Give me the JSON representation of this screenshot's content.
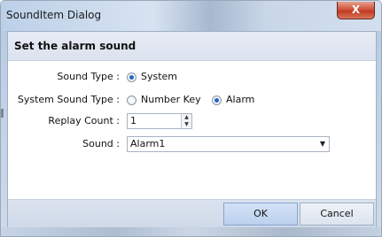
{
  "window": {
    "title": "SoundItem Dialog",
    "close_glyph": "X"
  },
  "header": {
    "title": "Set the alarm sound"
  },
  "sound_type": {
    "label": "Sound Type :",
    "options": [
      {
        "label": "System",
        "checked": true
      }
    ]
  },
  "system_sound_type": {
    "label": "System Sound Type :",
    "options": [
      {
        "label": "Number Key",
        "checked": false
      },
      {
        "label": "Alarm",
        "checked": true
      }
    ]
  },
  "replay_count": {
    "label": "Replay Count :",
    "value": "1",
    "up_glyph": "▲",
    "down_glyph": "▼"
  },
  "sound": {
    "label": "Sound :",
    "selected": "Alarm1",
    "arrow_glyph": "▼"
  },
  "buttons": {
    "ok": "OK",
    "cancel": "Cancel"
  },
  "colors": {
    "accent": "#1e66c9",
    "close_red": "#c13a20"
  }
}
